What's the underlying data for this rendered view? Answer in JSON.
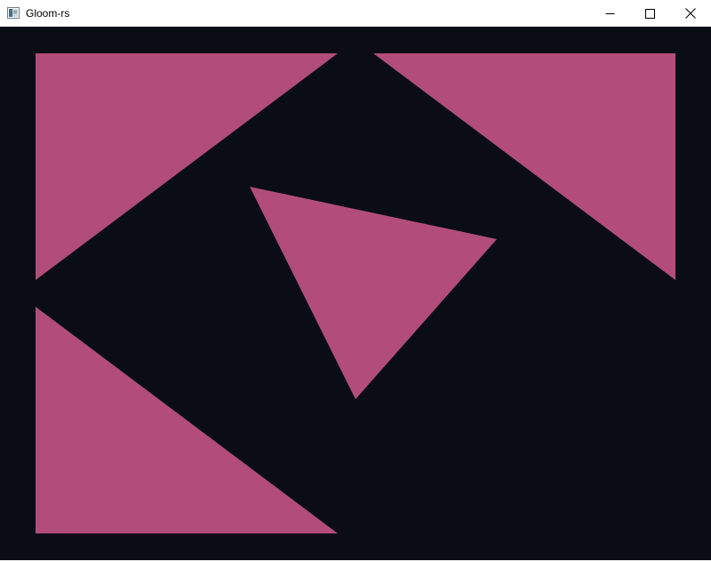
{
  "window": {
    "title": "Gloom-rs",
    "icon": "app-window-icon",
    "controls": {
      "minimize_icon": "minimize-icon",
      "maximize_icon": "maximize-icon",
      "close_icon": "close-icon"
    }
  },
  "render": {
    "background_color": "#0b0d16",
    "shape_color": "#b24d7b"
  }
}
